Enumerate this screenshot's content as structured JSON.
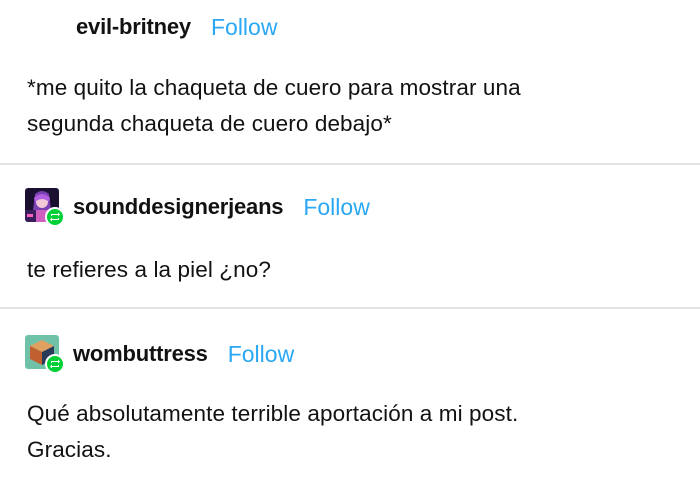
{
  "posts": [
    {
      "username": "evil-britney",
      "follow_label": "Follow",
      "text": [
        "*me quito la chaqueta de cuero para mostrar una",
        "segunda chaqueta de cuero debajo*"
      ]
    },
    {
      "username": "sounddesignerjeans",
      "follow_label": "Follow",
      "text": [
        "te refieres a la piel ¿no?"
      ],
      "avatar_icon": "avatar-purple-character-icon",
      "badge_icon": "reblog-icon"
    },
    {
      "username": "wombuttress",
      "follow_label": "Follow",
      "text": [
        "Qué absolutamente terrible aportación a mi post.",
        "Gracias."
      ],
      "avatar_icon": "avatar-cube-icon",
      "badge_icon": "reblog-icon"
    }
  ],
  "colors": {
    "follow": "#2aa8f4",
    "reblog_badge": "#00cf35",
    "divider": "#e3e3e3"
  }
}
